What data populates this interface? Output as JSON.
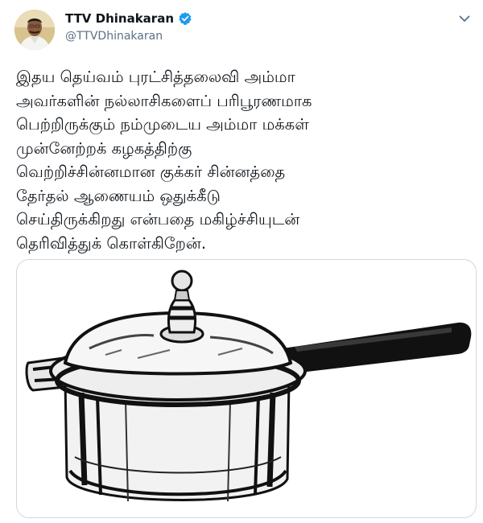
{
  "tweet": {
    "author": {
      "display_name": "TTV Dhinakaran",
      "handle": "@TTVDhinakaran",
      "verified": true,
      "avatar_icon": "profile-photo"
    },
    "menu_icon": "chevron-down-icon",
    "text_lines": [
      "இதய தெய்வம் புரட்சித்தலைவி அம்மா",
      "அவர்களின் நல்லாசிகளைப் பரிபூரணமாக",
      "பெற்றிருக்கும் நம்முடைய அம்மா மக்கள்",
      "முன்னேற்றக் கழகத்திற்கு",
      "வெற்றிச்சின்னமான குக்கர் சின்னத்தை",
      "தேர்தல் ஆணையம் ஒதுக்கீடு",
      "செய்திருக்கிறது என்பதை மகிழ்ச்சியுடன்",
      "தெரிவித்துக் கொள்கிறேன்."
    ],
    "media": {
      "kind": "image",
      "subject": "pressure-cooker-illustration"
    },
    "colors": {
      "verified_blue": "#1d9bf0",
      "handle_gray": "#5b7083",
      "border": "#cfd9de"
    }
  }
}
